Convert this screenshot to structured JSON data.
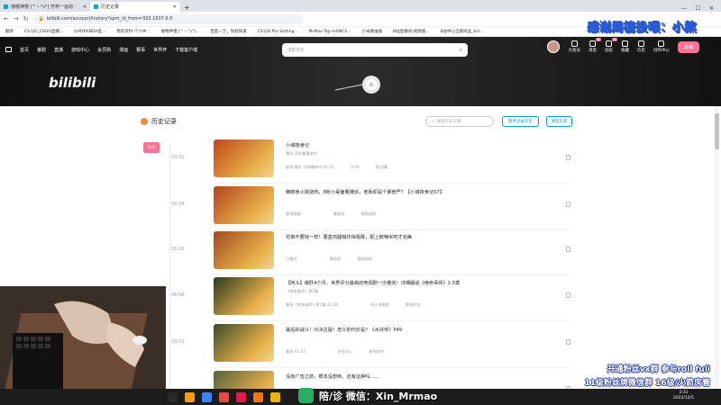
{
  "browser": {
    "tabs": [
      {
        "label": "咖喱神慢 [^ヽ°ɔ°] 开杯一运动 -",
        "active": false
      },
      {
        "label": "历史记录",
        "active": true
      }
    ],
    "new_tab": "+",
    "url": "bilibili.com/account/history?spm_id_from=333.1007.0.0",
    "bookmarks": [
      "翻译",
      "CS:GO_CSGO直播...",
      "ILMYRANDA直...",
      "我的资料-个人中...",
      "咖喱神慢 [^ヽ°ɔ°]...",
      "百度一下，你就知道",
      "CS:GO Pro Setting...",
      "MrMao Top-mANCS...",
      "小米路由器",
      "B站直播间-视频观...",
      "B站中心全部商品_bili..."
    ]
  },
  "nav": {
    "items": [
      "首页",
      "番剧",
      "直播",
      "游戏中心",
      "会员购",
      "漫画",
      "赛事",
      "世界杯",
      "下载客户端"
    ],
    "search_placeholder": "电影活动",
    "right": [
      "大会员",
      "消息",
      "动态",
      "收藏",
      "历史",
      "创作中心"
    ],
    "badges": {
      "messages": "41",
      "dynamic": "38"
    },
    "upload_label": "投稿"
  },
  "logo_text": "bilibili",
  "overlay_top": "感谢周榜投喂：小熬",
  "history": {
    "title": "历史记录",
    "search_placeholder": "搜索历史记录",
    "btn_pause": "暂停记录历史",
    "btn_clear": "清空历史",
    "today_label": "今天",
    "items": [
      {
        "time": "03:31",
        "title": "小城夜食记",
        "subtitle": "番外·开始看播放中",
        "meta": [
          "星剧·番外 开始播放中 01:32",
          "主UP",
          "第10集"
        ],
        "thumb_color": "#c0471b"
      },
      {
        "time": "03:28",
        "title": "精鲜食火锅烧肉，8粉小桌面看摊派，老板却是个暴管严？【小城夜食记07】",
        "meta": [
          "暂停观看",
          "",
          "曼妮宿 ",
          "视频加快"
        ],
        "thumb_color": "#b3421f"
      },
      {
        "time": "03:26",
        "title": "花椒不要钱一样！蕾盒鸡腿械炸得极酥，配上鲜辣米吧才完美",
        "meta": [
          "已看完",
          "",
          "曼妮宿",
          "视频加快"
        ],
        "thumb_color": "#a04a20"
      },
      {
        "time": "06:56",
        "title": "【阿斗】爆肝4个月，世界评分最高的电视剧一次看完！详细解说《绝命毒师》1-5季",
        "subtitle": "《绝命毒师》第1集",
        "meta": [
          "看到《绝命毒师》第1集 25:24",
          "",
          "阿斗说电影",
          "影视综合"
        ],
        "thumb_color": "#2a3b1e"
      },
      {
        "time": "03:53",
        "title": "最后的战斗！对决古猛！忠义的代价是？《水浒传》P49",
        "meta": [
          "看到 01:13",
          "",
          "木鱼水心",
          "影视综合"
        ],
        "thumb_color": "#3c4a2a"
      },
      {
        "time": "",
        "title": "没有广告之前，根本没想到，还有这种吗……",
        "meta": [],
        "thumb_color": "#55623a"
      }
    ]
  },
  "overlay_bottom": {
    "line1": "开通粉丝vx群 参与roll fuli",
    "line2": "11级粉丝牌微信群 16级/火箭房管",
    "wechat": "陪/诊 微信：Xin_Mrmao"
  },
  "taskbar": {
    "time": "3:31",
    "date": "2022/12/5"
  },
  "colors": {
    "accent": "#fb7299",
    "link": "#00a1d6"
  }
}
